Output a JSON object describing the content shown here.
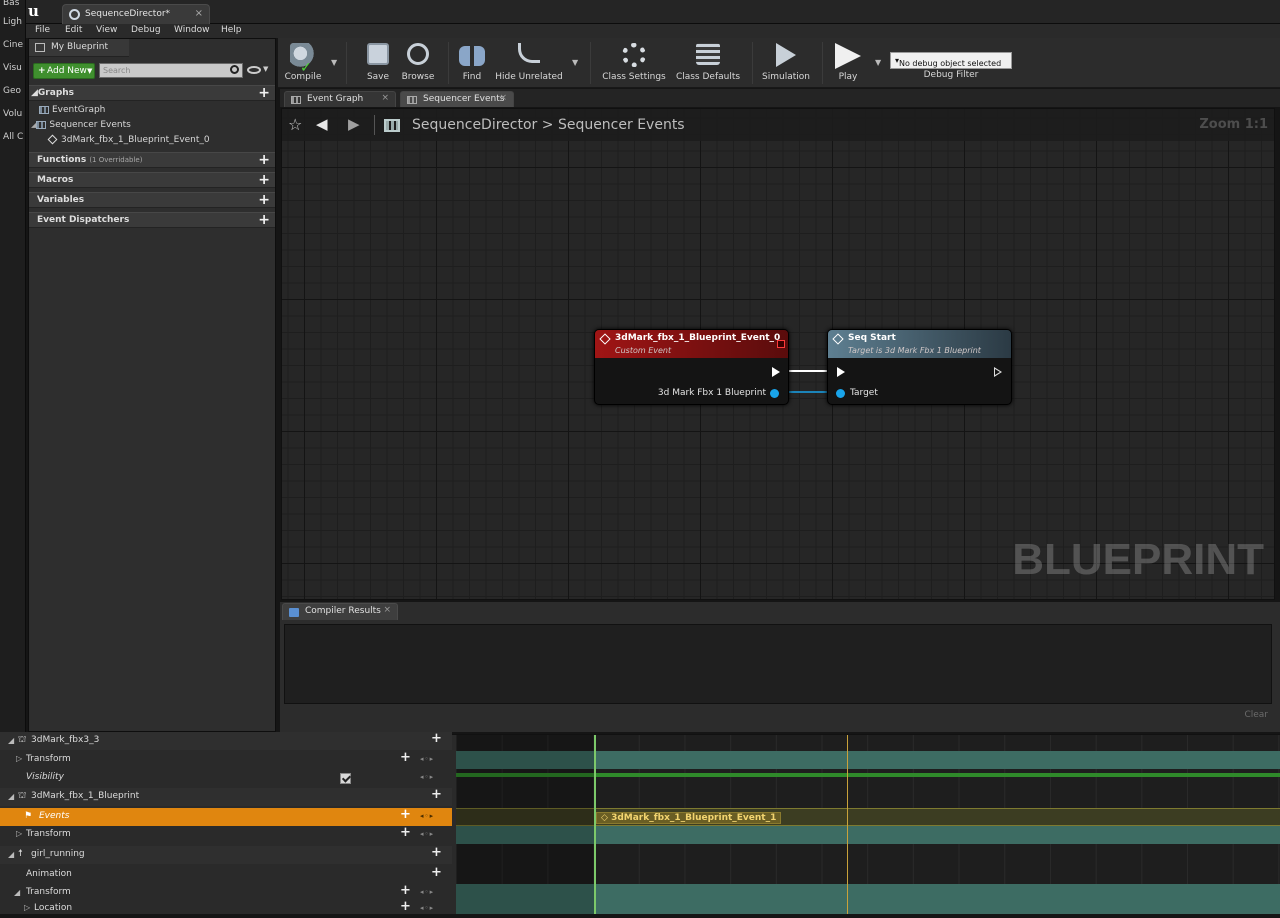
{
  "left_strip": [
    "Bas",
    "Ligh",
    "Cine",
    "Visu",
    "Geo",
    "Volu",
    "All C"
  ],
  "title_bar": {
    "tab_title": "SequenceDirector*"
  },
  "menu": [
    "File",
    "Edit",
    "View",
    "Debug",
    "Window",
    "Help"
  ],
  "my_blueprint": {
    "tab_label": "My Blueprint",
    "add_new_label": "Add New",
    "search_placeholder": "Search",
    "graphs_label": "Graphs",
    "graph_items": [
      "EventGraph",
      "Sequencer Events"
    ],
    "event_item": "3dMark_fbx_1_Blueprint_Event_0",
    "functions_label": "Functions",
    "functions_sub": "(1 Overridable)",
    "macros_label": "Macros",
    "variables_label": "Variables",
    "dispatchers_label": "Event Dispatchers"
  },
  "toolbar": {
    "compile": "Compile",
    "save": "Save",
    "browse": "Browse",
    "find": "Find",
    "hide_unrelated": "Hide Unrelated",
    "class_settings": "Class Settings",
    "class_defaults": "Class Defaults",
    "simulation": "Simulation",
    "play": "Play",
    "debug_select": "No debug object selected",
    "debug_filter": "Debug Filter"
  },
  "graph_tabs": [
    "Event Graph",
    "Sequencer Events"
  ],
  "graph": {
    "breadcrumb_root": "SequenceDirector",
    "breadcrumb_sep": ">",
    "breadcrumb_current": "Sequencer Events",
    "zoom": "Zoom 1:1",
    "watermark": "BLUEPRINT",
    "node_event": {
      "title": "3dMark_fbx_1_Blueprint_Event_0",
      "subtitle": "Custom Event",
      "output_pin": "3d Mark Fbx 1 Blueprint",
      "header_color": "#a01515"
    },
    "node_call": {
      "title": "Seq Start",
      "subtitle": "Target is 3d Mark Fbx 1 Blueprint",
      "target_pin": "Target",
      "header_color": "#5e7f91"
    }
  },
  "compiler": {
    "tab_label": "Compiler Results",
    "clear_label": "Clear"
  },
  "sequencer": {
    "rows": [
      {
        "label": "3dMark_fbx3_3",
        "kind": "object"
      },
      {
        "label": "Transform",
        "kind": "track"
      },
      {
        "label": "Visibility",
        "kind": "track-italic"
      },
      {
        "label": "3dMark_fbx_1_Blueprint",
        "kind": "object"
      },
      {
        "label": "Events",
        "kind": "selected"
      },
      {
        "label": "Transform",
        "kind": "track"
      },
      {
        "label": "girl_running",
        "kind": "object"
      },
      {
        "label": "Animation",
        "kind": "track"
      },
      {
        "label": "Transform",
        "kind": "track"
      },
      {
        "label": "Location",
        "kind": "sub"
      }
    ],
    "event_key_label": "3dMark_fbx_1_Blueprint_Event_1"
  }
}
